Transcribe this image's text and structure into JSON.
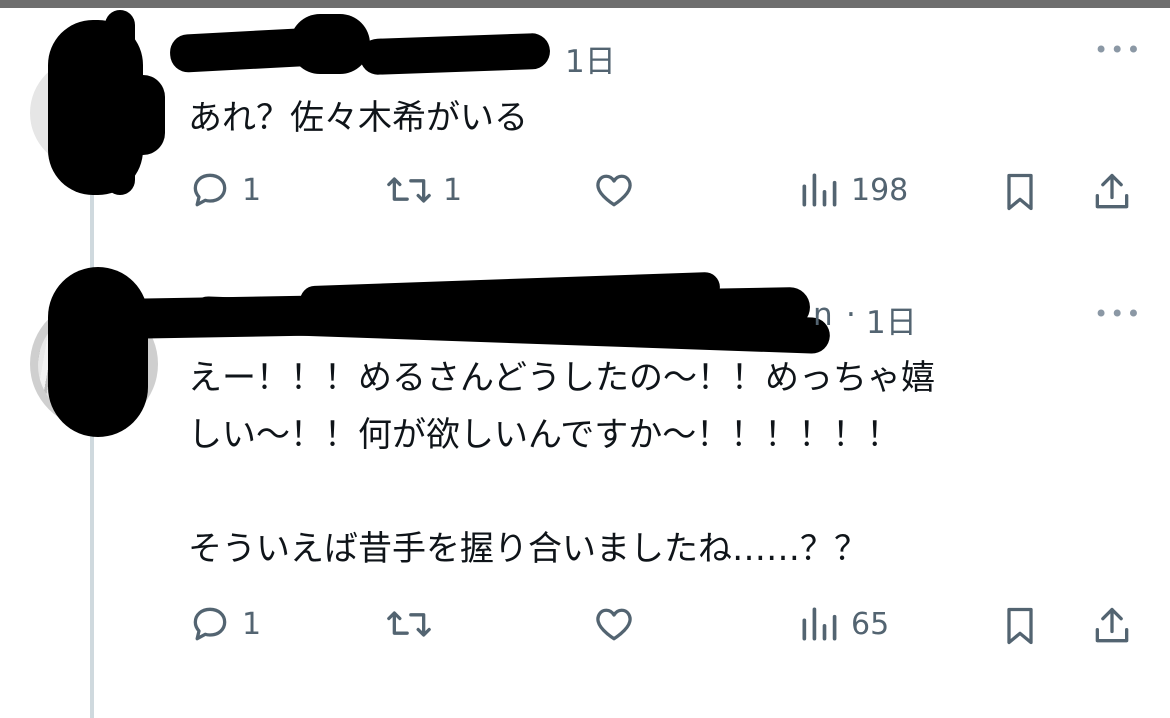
{
  "tweets": [
    {
      "time": "1日",
      "more": "•••",
      "text": "あれ？佐々木希がいる",
      "replies": "1",
      "retweets": "1",
      "likes": "",
      "views": "198"
    },
    {
      "handle_tail": "n",
      "time": "1日",
      "more": "•••",
      "text": "えー！！！めるさんどうしたの〜！！めっちゃ嬉\nしい〜！！何が欲しいんですか〜！！！！！！\n\nそういえば昔手を握り合いましたね……？？",
      "replies": "1",
      "retweets": "",
      "likes": "",
      "views": "65"
    }
  ],
  "icons": {
    "reply": "reply-bubble-icon",
    "retweet": "retweet-icon",
    "like": "heart-icon",
    "views": "views-chart-icon",
    "bookmark": "bookmark-icon",
    "share": "share-upload-icon",
    "more": "more-dots-icon"
  },
  "colors": {
    "text": "#0f1419",
    "secondary": "#536471",
    "thread_line": "#cfd9de",
    "top_bar": "#6e6e6e"
  }
}
